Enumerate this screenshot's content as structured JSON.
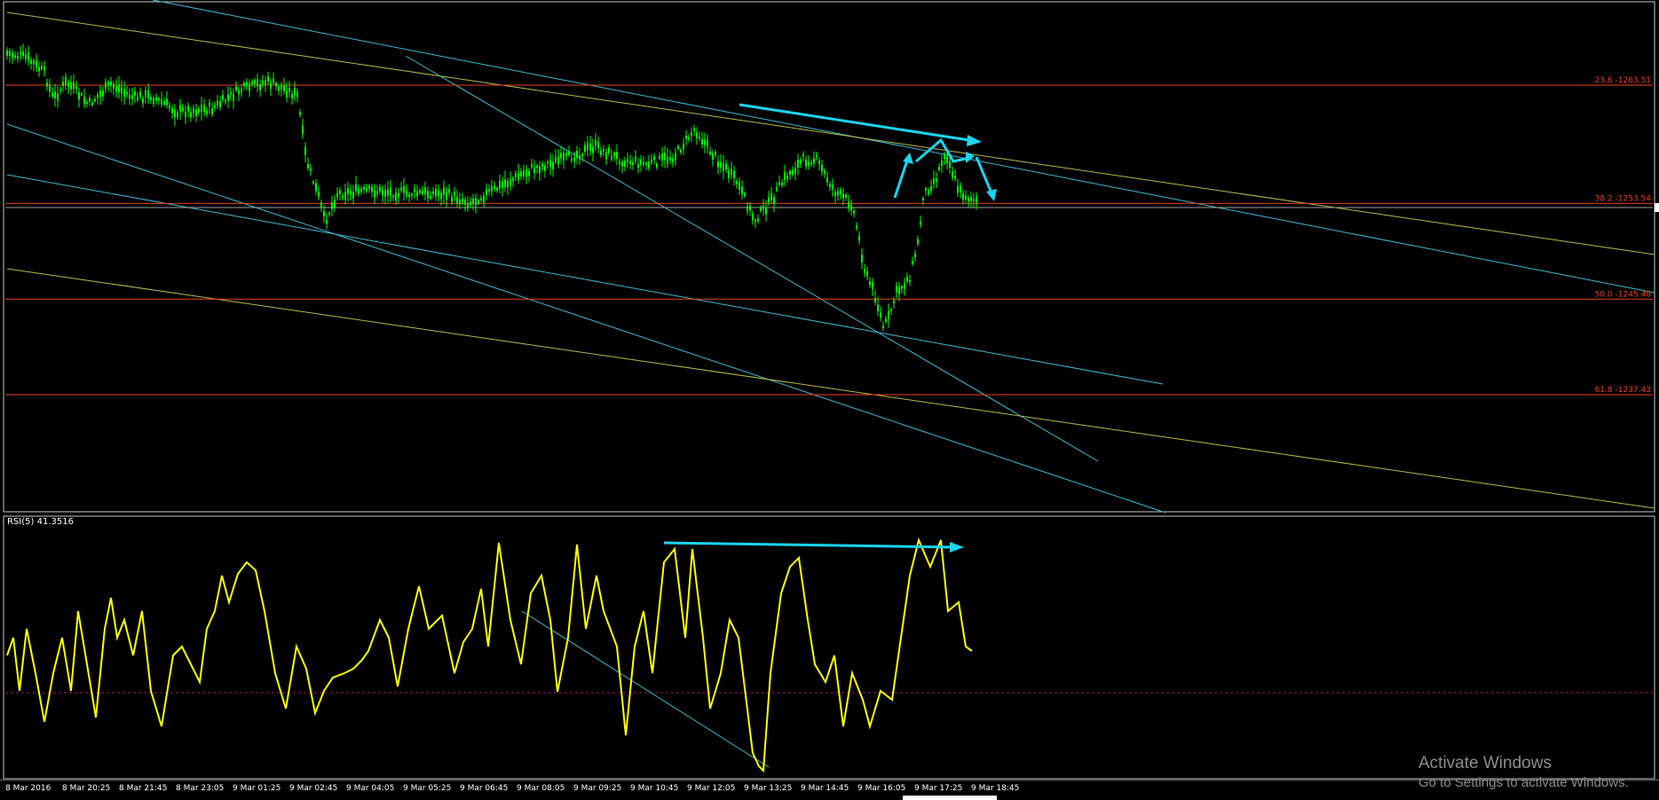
{
  "colors": {
    "background": "#000000",
    "candles": "#00ff00",
    "fib_lines": "#e8401c",
    "fib_labels": "#e8401c",
    "trendline_cyan": "#37b9d6",
    "trendline_yellow": "#b8b840",
    "arrow": "#1ad5f0",
    "rsi_line": "#ffff00",
    "rsi_level": "#a01870",
    "panel_border": "#c8c8c8",
    "axis_text": "#ffffff"
  },
  "main": {
    "fib_levels": [
      {
        "label": "23.6 -1263.51",
        "price": 1263.51
      },
      {
        "label": "38.2 -1253.54",
        "price": 1253.54
      },
      {
        "label": "50.0 -1245.48",
        "price": 1245.48
      },
      {
        "label": "61.8 -1237.43",
        "price": 1237.43
      }
    ]
  },
  "rsi": {
    "title": "RSI(5) 41.3516",
    "period": 5,
    "last_value": 41.3516,
    "level": 50
  },
  "time_axis": {
    "labels": [
      "8 Mar 2016",
      "8 Mar 20:25",
      "8 Mar 21:45",
      "8 Mar 23:05",
      "9 Mar 01:25",
      "9 Mar 02:45",
      "9 Mar 04:05",
      "9 Mar 05:25",
      "9 Mar 06:45",
      "9 Mar 08:05",
      "9 Mar 09:25",
      "9 Mar 10:45",
      "9 Mar 12:05",
      "9 Mar 13:25",
      "9 Mar 14:45",
      "9 Mar 16:05",
      "9 Mar 17:25",
      "9 Mar 18:45"
    ]
  },
  "watermark": {
    "line1": "Activate Windows",
    "line2": "Go to Settings to activate Windows."
  }
}
